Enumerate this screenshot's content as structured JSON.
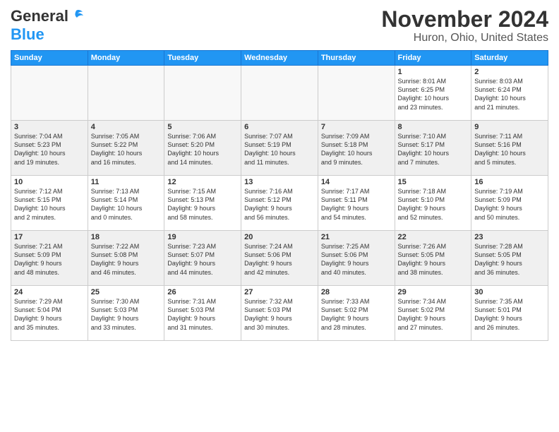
{
  "header": {
    "logo_general": "General",
    "logo_blue": "Blue",
    "month_title": "November 2024",
    "location": "Huron, Ohio, United States"
  },
  "weekdays": [
    "Sunday",
    "Monday",
    "Tuesday",
    "Wednesday",
    "Thursday",
    "Friday",
    "Saturday"
  ],
  "weeks": [
    [
      {
        "day": "",
        "info": "",
        "empty": true
      },
      {
        "day": "",
        "info": "",
        "empty": true
      },
      {
        "day": "",
        "info": "",
        "empty": true
      },
      {
        "day": "",
        "info": "",
        "empty": true
      },
      {
        "day": "",
        "info": "",
        "empty": true
      },
      {
        "day": "1",
        "info": "Sunrise: 8:01 AM\nSunset: 6:25 PM\nDaylight: 10 hours\nand 23 minutes."
      },
      {
        "day": "2",
        "info": "Sunrise: 8:03 AM\nSunset: 6:24 PM\nDaylight: 10 hours\nand 21 minutes."
      }
    ],
    [
      {
        "day": "3",
        "info": "Sunrise: 7:04 AM\nSunset: 5:23 PM\nDaylight: 10 hours\nand 19 minutes."
      },
      {
        "day": "4",
        "info": "Sunrise: 7:05 AM\nSunset: 5:22 PM\nDaylight: 10 hours\nand 16 minutes."
      },
      {
        "day": "5",
        "info": "Sunrise: 7:06 AM\nSunset: 5:20 PM\nDaylight: 10 hours\nand 14 minutes."
      },
      {
        "day": "6",
        "info": "Sunrise: 7:07 AM\nSunset: 5:19 PM\nDaylight: 10 hours\nand 11 minutes."
      },
      {
        "day": "7",
        "info": "Sunrise: 7:09 AM\nSunset: 5:18 PM\nDaylight: 10 hours\nand 9 minutes."
      },
      {
        "day": "8",
        "info": "Sunrise: 7:10 AM\nSunset: 5:17 PM\nDaylight: 10 hours\nand 7 minutes."
      },
      {
        "day": "9",
        "info": "Sunrise: 7:11 AM\nSunset: 5:16 PM\nDaylight: 10 hours\nand 5 minutes."
      }
    ],
    [
      {
        "day": "10",
        "info": "Sunrise: 7:12 AM\nSunset: 5:15 PM\nDaylight: 10 hours\nand 2 minutes."
      },
      {
        "day": "11",
        "info": "Sunrise: 7:13 AM\nSunset: 5:14 PM\nDaylight: 10 hours\nand 0 minutes."
      },
      {
        "day": "12",
        "info": "Sunrise: 7:15 AM\nSunset: 5:13 PM\nDaylight: 9 hours\nand 58 minutes."
      },
      {
        "day": "13",
        "info": "Sunrise: 7:16 AM\nSunset: 5:12 PM\nDaylight: 9 hours\nand 56 minutes."
      },
      {
        "day": "14",
        "info": "Sunrise: 7:17 AM\nSunset: 5:11 PM\nDaylight: 9 hours\nand 54 minutes."
      },
      {
        "day": "15",
        "info": "Sunrise: 7:18 AM\nSunset: 5:10 PM\nDaylight: 9 hours\nand 52 minutes."
      },
      {
        "day": "16",
        "info": "Sunrise: 7:19 AM\nSunset: 5:09 PM\nDaylight: 9 hours\nand 50 minutes."
      }
    ],
    [
      {
        "day": "17",
        "info": "Sunrise: 7:21 AM\nSunset: 5:09 PM\nDaylight: 9 hours\nand 48 minutes."
      },
      {
        "day": "18",
        "info": "Sunrise: 7:22 AM\nSunset: 5:08 PM\nDaylight: 9 hours\nand 46 minutes."
      },
      {
        "day": "19",
        "info": "Sunrise: 7:23 AM\nSunset: 5:07 PM\nDaylight: 9 hours\nand 44 minutes."
      },
      {
        "day": "20",
        "info": "Sunrise: 7:24 AM\nSunset: 5:06 PM\nDaylight: 9 hours\nand 42 minutes."
      },
      {
        "day": "21",
        "info": "Sunrise: 7:25 AM\nSunset: 5:06 PM\nDaylight: 9 hours\nand 40 minutes."
      },
      {
        "day": "22",
        "info": "Sunrise: 7:26 AM\nSunset: 5:05 PM\nDaylight: 9 hours\nand 38 minutes."
      },
      {
        "day": "23",
        "info": "Sunrise: 7:28 AM\nSunset: 5:05 PM\nDaylight: 9 hours\nand 36 minutes."
      }
    ],
    [
      {
        "day": "24",
        "info": "Sunrise: 7:29 AM\nSunset: 5:04 PM\nDaylight: 9 hours\nand 35 minutes."
      },
      {
        "day": "25",
        "info": "Sunrise: 7:30 AM\nSunset: 5:03 PM\nDaylight: 9 hours\nand 33 minutes."
      },
      {
        "day": "26",
        "info": "Sunrise: 7:31 AM\nSunset: 5:03 PM\nDaylight: 9 hours\nand 31 minutes."
      },
      {
        "day": "27",
        "info": "Sunrise: 7:32 AM\nSunset: 5:03 PM\nDaylight: 9 hours\nand 30 minutes."
      },
      {
        "day": "28",
        "info": "Sunrise: 7:33 AM\nSunset: 5:02 PM\nDaylight: 9 hours\nand 28 minutes."
      },
      {
        "day": "29",
        "info": "Sunrise: 7:34 AM\nSunset: 5:02 PM\nDaylight: 9 hours\nand 27 minutes."
      },
      {
        "day": "30",
        "info": "Sunrise: 7:35 AM\nSunset: 5:01 PM\nDaylight: 9 hours\nand 26 minutes."
      }
    ]
  ]
}
